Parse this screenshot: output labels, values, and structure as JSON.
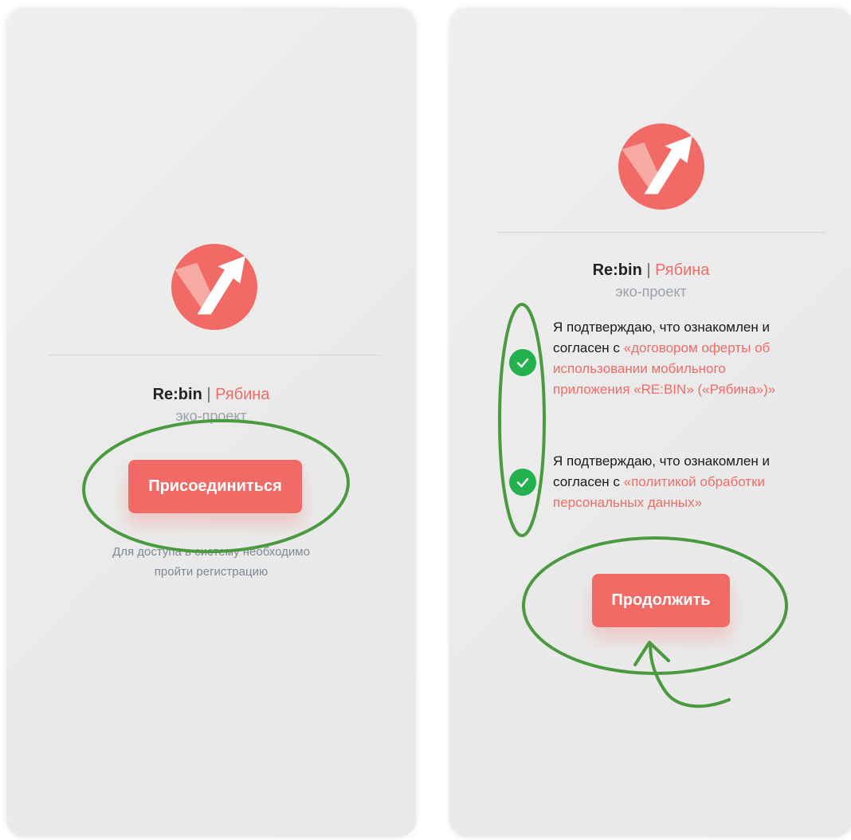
{
  "left_screen": {
    "brand_name": "Re:bin",
    "brand_separator": " | ",
    "brand_name_ru": "Рябина",
    "subtitle": "эко-проект",
    "join_button": "Присоединиться",
    "hint_line1": "Для доступа в систему необходимо",
    "hint_line2": "пройти регистрацию"
  },
  "right_screen": {
    "brand_name": "Re:bin",
    "brand_separator": " | ",
    "brand_name_ru": "Рябина",
    "subtitle": "эко-проект",
    "agreement_1": {
      "line1": "Я подтверждаю, что ознакомлен и",
      "line2_prefix": "согласен с ",
      "link_line2": "«договором оферты об",
      "link_line3": "использовании мобильного",
      "link_line4": "приложения «RE:BIN» («Рябина»)»",
      "checked": true
    },
    "agreement_2": {
      "line1": "Я подтверждаю, что ознакомлен и",
      "line2_prefix": "согласен с ",
      "link_line2": "«политикой обработки",
      "link_line3": "персональных данных»",
      "checked": true
    },
    "continue_button": "Продолжить"
  },
  "colors": {
    "accent": "#f26a66",
    "check_green": "#22b14c",
    "annotation_green": "#4a9a3f",
    "screen_bg": "#ececec"
  },
  "icons": [
    "rebin-logo-icon",
    "checkmark-icon"
  ]
}
